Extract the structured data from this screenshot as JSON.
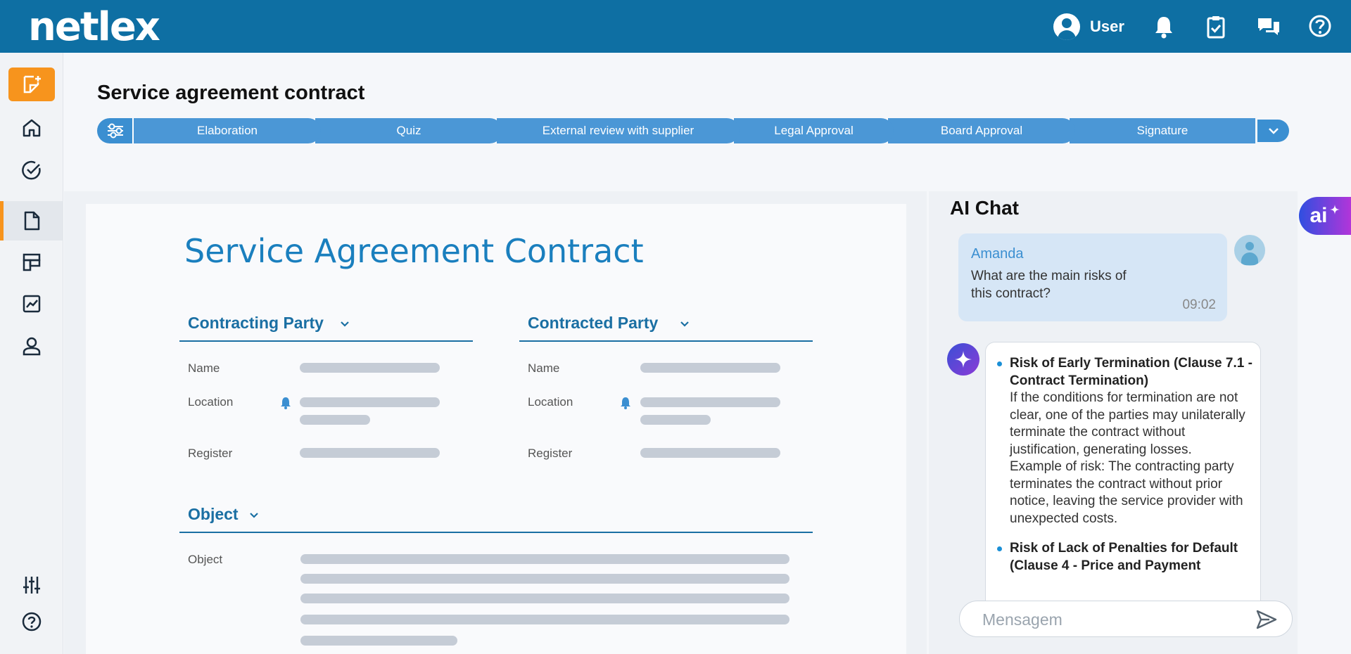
{
  "brand": {
    "logo_text": "netlex"
  },
  "header": {
    "user_label": "User",
    "icons": [
      "user-avatar-icon",
      "bell-icon",
      "clipboard-check-icon",
      "chat-icon",
      "help-icon"
    ]
  },
  "sidebar": {
    "items": [
      {
        "name": "new-document",
        "icon": "new-document-icon"
      },
      {
        "name": "home",
        "icon": "home-icon"
      },
      {
        "name": "tasks",
        "icon": "check-circle-icon"
      },
      {
        "name": "documents",
        "icon": "document-icon",
        "active": true
      },
      {
        "name": "templates",
        "icon": "templates-icon"
      },
      {
        "name": "analytics",
        "icon": "chart-icon"
      },
      {
        "name": "profile",
        "icon": "person-icon"
      },
      {
        "name": "settings",
        "icon": "sliders-icon"
      },
      {
        "name": "help",
        "icon": "help-icon"
      }
    ]
  },
  "page": {
    "title": "Service agreement contract",
    "steps": [
      "Elaboration",
      "Quiz",
      "External review with supplier",
      "Legal Approval",
      "Board Approval",
      "Signature"
    ]
  },
  "document": {
    "title": "Service Agreement Contract",
    "contracting": {
      "heading": "Contracting Party",
      "name_label": "Name",
      "location_label": "Location",
      "register_label": "Register"
    },
    "contracted": {
      "heading": "Contracted Party",
      "name_label": "Name",
      "location_label": "Location",
      "register_label": "Register"
    },
    "object": {
      "heading": "Object",
      "object_label": "Object"
    }
  },
  "chat": {
    "title": "AI Chat",
    "user_message": {
      "name": "Amanda",
      "text": "What are the main risks of this contract?",
      "time": "09:02"
    },
    "ai_risks": [
      {
        "title": "Risk of Early Termination (Clause 7.1 - Contract Termination)",
        "body": "If the conditions for termination are not clear, one of the parties may unilaterally terminate the contract without justification, generating losses.",
        "example": "Example of risk: The contracting party terminates the contract without prior notice, leaving the service provider with unexpected costs."
      },
      {
        "title": "Risk of Lack of Penalties for Default (Clause 4 - Price and Payment",
        "body": "",
        "example": ""
      }
    ],
    "input_placeholder": "Mensagem",
    "fab_label": "ai"
  },
  "colors": {
    "topbar": "#0e6fa3",
    "accent_orange": "#f7941d",
    "step_blue": "#4b97d6",
    "section_blue": "#1a6fa3",
    "title_blue": "#1a7fbe"
  }
}
